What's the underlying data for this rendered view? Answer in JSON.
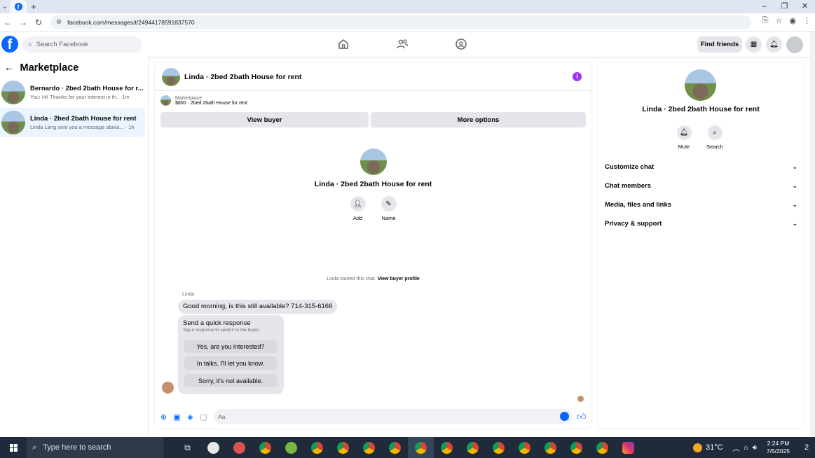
{
  "browser": {
    "url": "facebook.com/messages/t/24944178591837570",
    "new_tab_label": "+",
    "window_controls": [
      "–",
      "❐",
      "✕"
    ]
  },
  "fb_header": {
    "logo": "f",
    "search_placeholder": "Search Facebook",
    "find_friends": "Find friends",
    "nav_icons": [
      "home-icon",
      "friends-icon",
      "groups-icon"
    ]
  },
  "sidebar": {
    "title": "Marketplace",
    "conversations": [
      {
        "name": "Bernardo · 2bed 2bath House for r...",
        "preview": "You: Hi! Thanks for your interest in th...  1m",
        "selected": false
      },
      {
        "name": "Linda · 2bed 2bath House for rent",
        "preview": "Linda Lang sent you a message about... · 1h",
        "selected": true
      }
    ]
  },
  "chat": {
    "title": "Linda · 2bed 2bath House for rent",
    "marketplace_label": "Marketplace",
    "listing": "$800 · 2bed 2bath House for rent",
    "view_buyer": "View buyer",
    "more_options": "More options",
    "center_title": "Linda · 2bed 2bath House for rent",
    "actions": [
      {
        "label": "Add"
      },
      {
        "label": "Name"
      }
    ],
    "started_text": "Linda started this chat.",
    "view_profile": "View buyer profile",
    "sender": "Linda",
    "message": "Good morning, is this still available?  714-315-6166",
    "quick_title": "Send a quick response",
    "quick_sub": "Tap a response to send it to the buyer.",
    "quick_responses": [
      "Yes, are you interested?",
      "In talks. I'll let you know.",
      "Sorry, it's not available."
    ],
    "composer_placeholder": "Aa"
  },
  "details": {
    "title": "Linda · 2bed 2bath House for rent",
    "actions": [
      {
        "label": "Mute"
      },
      {
        "label": "Search"
      }
    ],
    "sections": [
      "Customize chat",
      "Chat members",
      "Media, files and links",
      "Privacy & support"
    ]
  },
  "taskbar": {
    "search_placeholder": "Type here to search",
    "temperature": "31°C",
    "time": "2:24 PM",
    "date": "7/5/2025",
    "notification_count": "2"
  }
}
